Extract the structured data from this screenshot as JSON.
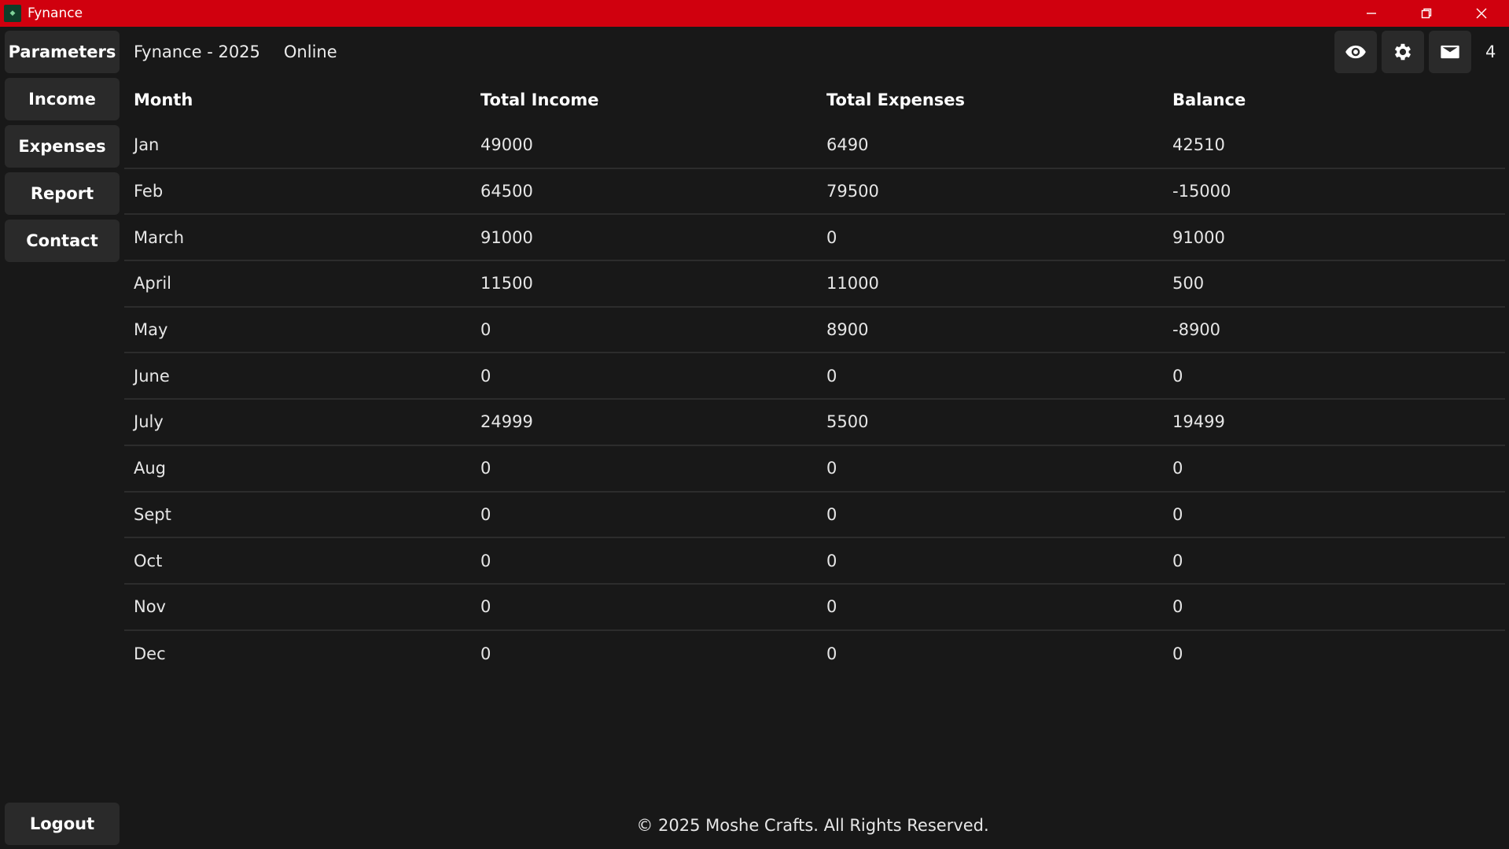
{
  "window": {
    "title": "Fynance"
  },
  "sidebar": {
    "items": [
      {
        "label": "Parameters"
      },
      {
        "label": "Income"
      },
      {
        "label": "Expenses"
      },
      {
        "label": "Report"
      },
      {
        "label": "Contact"
      }
    ],
    "logout_label": "Logout"
  },
  "header": {
    "title": "Fynance - 2025",
    "status": "Online",
    "actions": [
      "eye-icon",
      "gear-icon",
      "mail-icon"
    ],
    "count": "4"
  },
  "table": {
    "columns": [
      "Month",
      "Total Income",
      "Total Expenses",
      "Balance"
    ],
    "rows": [
      [
        "Jan",
        "49000",
        "6490",
        "42510"
      ],
      [
        "Feb",
        "64500",
        "79500",
        "-15000"
      ],
      [
        "March",
        "91000",
        "0",
        "91000"
      ],
      [
        "April",
        "11500",
        "11000",
        "500"
      ],
      [
        "May",
        "0",
        "8900",
        "-8900"
      ],
      [
        "June",
        "0",
        "0",
        "0"
      ],
      [
        "July",
        "24999",
        "5500",
        "19499"
      ],
      [
        "Aug",
        "0",
        "0",
        "0"
      ],
      [
        "Sept",
        "0",
        "0",
        "0"
      ],
      [
        "Oct",
        "0",
        "0",
        "0"
      ],
      [
        "Nov",
        "0",
        "0",
        "0"
      ],
      [
        "Dec",
        "0",
        "0",
        "0"
      ]
    ]
  },
  "footer": {
    "copyright": "© 2025 Moshe Crafts. All Rights Reserved."
  },
  "colors": {
    "titlebar": "#d0000e",
    "background": "#181818",
    "button": "#2a2a2a"
  }
}
